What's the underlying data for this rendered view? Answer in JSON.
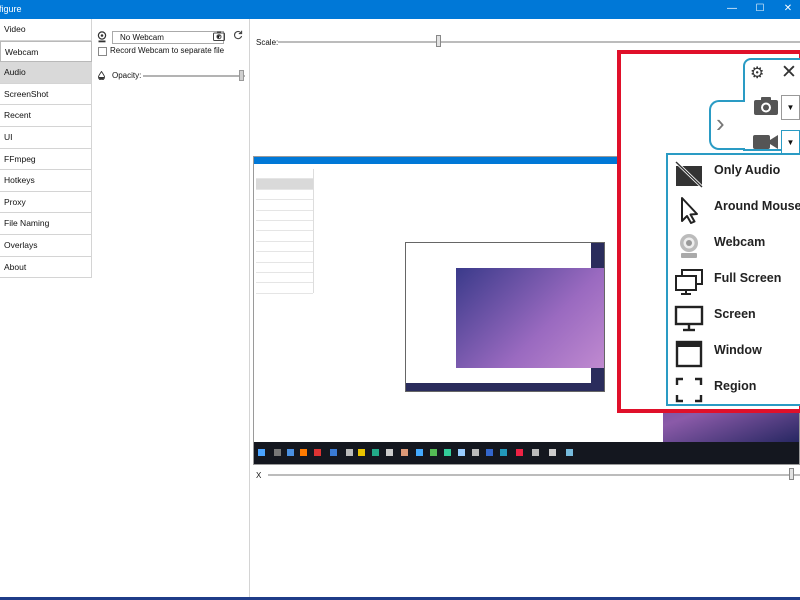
{
  "window": {
    "title": "nfigure",
    "minimize": "—",
    "maximize": "☐",
    "close": "✕"
  },
  "sidebar": {
    "items": [
      {
        "label": "Video"
      },
      {
        "label": "Webcam"
      },
      {
        "label": "Audio"
      },
      {
        "label": "ScreenShot"
      },
      {
        "label": "Recent"
      },
      {
        "label": "UI"
      },
      {
        "label": "FFmpeg"
      },
      {
        "label": "Hotkeys"
      },
      {
        "label": "Proxy"
      },
      {
        "label": "File Naming"
      },
      {
        "label": "Overlays"
      },
      {
        "label": "About"
      }
    ],
    "selected": "Webcam"
  },
  "webcam": {
    "device_value": "No Webcam",
    "record_separate_label": "Record Webcam to separate file",
    "record_separate_checked": false,
    "opacity_label": "Opacity:",
    "opacity_value": 1.0
  },
  "preview": {
    "scale_label": "Scale:",
    "scale_value": 0.3,
    "x_label": "X",
    "x_value": 0.99
  },
  "overlay": {
    "menu_items": [
      {
        "label": "Only Audio",
        "icon": "no-video-icon"
      },
      {
        "label": "Around Mouse",
        "icon": "cursor-icon"
      },
      {
        "label": "Webcam",
        "icon": "webcam-icon"
      },
      {
        "label": "Full Screen",
        "icon": "full-screen-icon"
      },
      {
        "label": "Screen",
        "icon": "monitor-icon"
      },
      {
        "label": "Window",
        "icon": "window-icon"
      },
      {
        "label": "Region",
        "icon": "region-icon"
      }
    ],
    "highlight_color": "#e0102a",
    "accent_color": "#2a9bc4"
  }
}
